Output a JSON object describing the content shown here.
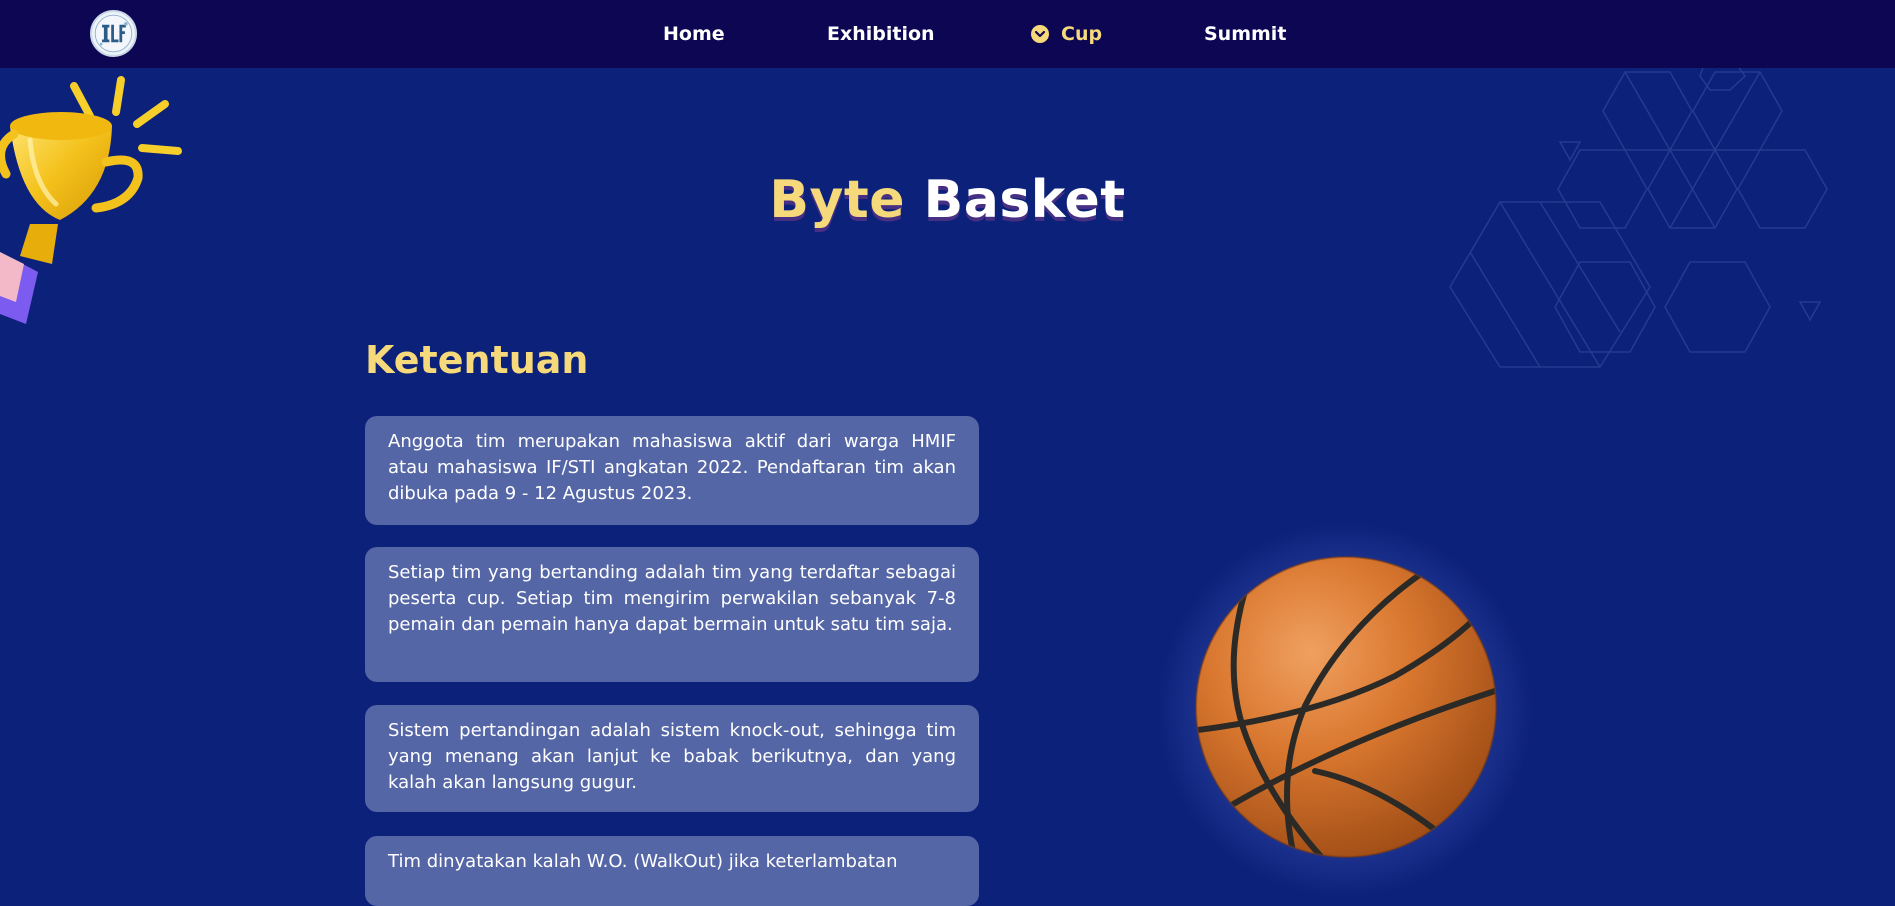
{
  "nav": {
    "logo_icon": "hmif-logo-icon",
    "items": [
      {
        "label": "Home"
      },
      {
        "label": "Exhibition"
      },
      {
        "label": "Cup",
        "icon": "chevron-down-icon",
        "active": true
      },
      {
        "label": "Summit"
      }
    ]
  },
  "hero": {
    "title_highlight": "Byte",
    "title_rest": "Basket"
  },
  "rules": {
    "heading": "Ketentuan",
    "items": [
      "Anggota tim merupakan mahasiswa aktif dari warga HMIF atau mahasiswa IF/STI angkatan 2022. Pendaftaran tim akan dibuka pada 9 - 12 Agustus 2023.",
      "Setiap tim yang bertanding adalah tim yang terdaftar sebagai peserta cup. Setiap tim mengirim perwakilan sebanyak 7-8 pemain dan pemain hanya dapat bermain untuk satu tim saja.",
      "Sistem pertandingan adalah sistem knock-out, sehingga tim yang menang akan lanjut ke babak berikutnya, dan yang kalah akan langsung gugur.",
      "Tim dinyatakan kalah W.O. (WalkOut) jika keterlambatan"
    ]
  },
  "decor": {
    "trophy": "trophy-icon",
    "basketball": "basketball-icon",
    "pattern": "hexagon-pattern"
  },
  "colors": {
    "background": "#0c2179",
    "navbar": "#0c0653",
    "accent": "#f5d97a",
    "card": "#5566a6"
  }
}
